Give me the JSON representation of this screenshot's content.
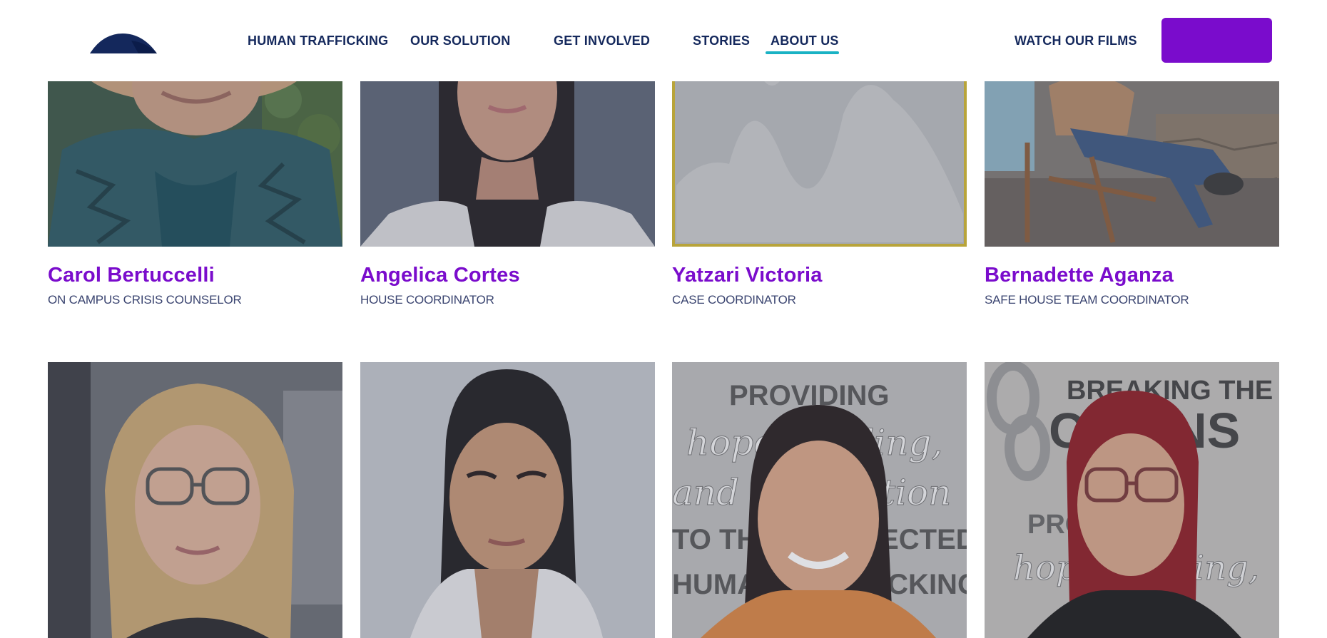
{
  "nav": {
    "items": [
      {
        "label": "HUMAN TRAFFICKING"
      },
      {
        "label": "OUR SOLUTION"
      },
      {
        "label": "GET INVOLVED"
      },
      {
        "label": "STORIES"
      },
      {
        "label": "ABOUT US"
      }
    ],
    "active": "ABOUT US",
    "watch_films": "WATCH OUR FILMS",
    "cta_label": ""
  },
  "colors": {
    "accent_purple": "#7a0ccc",
    "nav_text": "#14285c",
    "active_underline": "#1ab2c4",
    "placeholder_border": "#b8a43a"
  },
  "team": [
    {
      "name": "Carol Bertuccelli",
      "role": "ON CAMPUS CRISIS COUNSELOR",
      "photo": "carol-photo"
    },
    {
      "name": "Angelica Cortes",
      "role": "HOUSE COORDINATOR",
      "photo": "angelica-photo"
    },
    {
      "name": "Yatzari Victoria",
      "role": "CASE COORDINATOR",
      "photo": "placeholder-image-icon"
    },
    {
      "name": "Bernadette Aganza",
      "role": "SAFE HOUSE TEAM COORDINATOR",
      "photo": "bernadette-photo"
    },
    {
      "name": "",
      "role": "",
      "photo": "team-member-5-photo"
    },
    {
      "name": "",
      "role": "",
      "photo": "team-member-6-photo"
    },
    {
      "name": "",
      "role": "",
      "photo": "team-member-7-photo"
    },
    {
      "name": "",
      "role": "",
      "photo": "team-member-8-photo"
    }
  ],
  "backdrop_text": {
    "card7_line1": "PROVIDING",
    "card7_line2": "hope, healing,",
    "card7_line3": "and restoration",
    "card7_line4": "TO THOSE AFFECTED",
    "card7_line5": "HUMAN TRAFFICKING",
    "card8_line1": "BREAKING THE",
    "card8_line2": "CHAINS",
    "card8_line3": "PROVIDING",
    "card8_line4": "hope, healing,"
  }
}
